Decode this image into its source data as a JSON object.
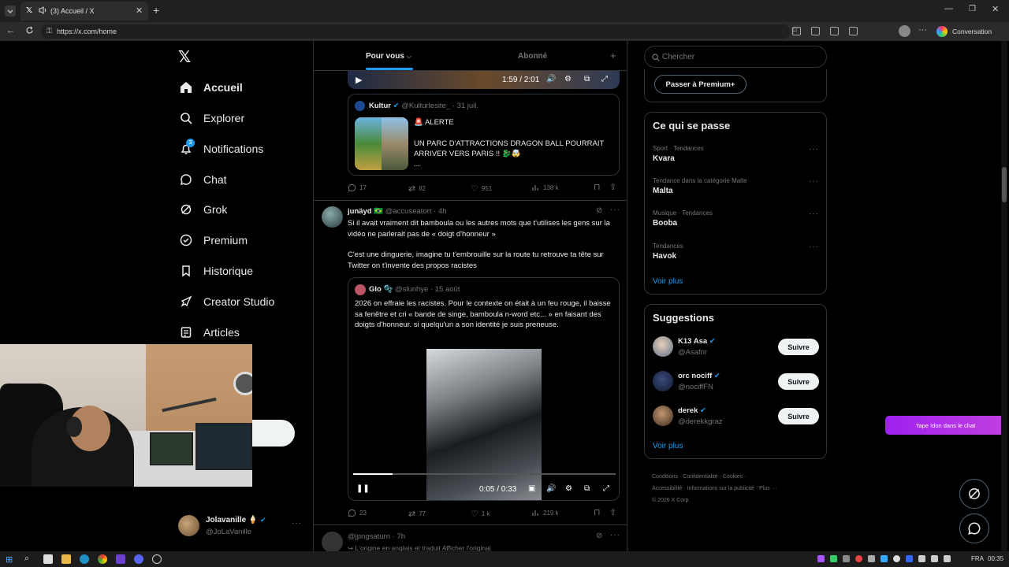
{
  "browser": {
    "tab_title": "(3) Accueil / X",
    "url": "https://x.com/home",
    "conversation_label": "Conversation"
  },
  "sidebar": {
    "items": [
      {
        "label": "Accueil",
        "icon": "home-icon"
      },
      {
        "label": "Explorer",
        "icon": "search-icon"
      },
      {
        "label": "Notifications",
        "icon": "bell-icon",
        "badge": "3"
      },
      {
        "label": "Chat",
        "icon": "chat-icon"
      },
      {
        "label": "Grok",
        "icon": "grok-icon"
      },
      {
        "label": "Premium",
        "icon": "verified-icon"
      },
      {
        "label": "Historique",
        "icon": "bookmark-icon"
      },
      {
        "label": "Creator Studio",
        "icon": "rocket-icon"
      },
      {
        "label": "Articles",
        "icon": "article-icon"
      }
    ],
    "account": {
      "name": "Jolavanille",
      "emoji": "🍦",
      "handle": "@JoLaVanille"
    }
  },
  "feed": {
    "tabs": [
      "Pour vous",
      "Abonné"
    ],
    "video1": {
      "time": "1:59 / 2:01"
    },
    "quote1": {
      "author": "Kultur",
      "handle": "@Kulturlesite_",
      "date": "· 31 juil.",
      "line1": "🚨 ALERTE",
      "line2": "UN PARC D'ATTRACTIONS DRAGON BALL POURRAIT ARRIVER VERS PARIS !! 🐉🤯",
      "line3": "..."
    },
    "stats1": {
      "replies": "17",
      "retweets": "82",
      "likes": "951",
      "views": "138 k"
    },
    "tweet2": {
      "author": "junäyd 🇧🇷",
      "handle": "@accuseatort",
      "time": "· 4h",
      "text1": "Si il avait vraiment dit bamboula ou les autres mots que t'utilises les gens sur la vidéo ne parlerait pas de « doigt d'honneur »",
      "text2": "C'est une dinguerie, imagine tu t'embrouille sur la route tu retrouve ta tête sur Twitter on t'invente des propos racistes",
      "quote": {
        "author": "Glo 🫧",
        "handle": "@slunhye",
        "date": "· 15 août",
        "text": "2026 on effraie les racistes. Pour le contexte on était à un feu rouge, il baisse sa fenêtre et cri «  bande de singe, bamboula n-word etc... » en faisant des doigts d'honneur. si quelqu'un a son identité je suis preneuse."
      },
      "video_time": "0:05 / 0:33",
      "video_progress": 0.15,
      "stats": {
        "replies": "23",
        "retweets": "77",
        "likes": "1 k",
        "views": "219 k"
      }
    },
    "tweet3": {
      "handle": "@jpngsaturn",
      "time": "· 7h",
      "line": "↪ L'origine en anglais et traduit  Afficher l'original"
    }
  },
  "right": {
    "search_placeholder": "Chercher",
    "premium_button": "Passer à Premium+",
    "trends_title": "Ce qui se passe",
    "trends": [
      {
        "cat": "Sport · Tendances",
        "name": "Kvara"
      },
      {
        "cat": "Tendance dans la catégorie Malte",
        "name": "Malta"
      },
      {
        "cat": "Musique · Tendances",
        "name": "Booba"
      },
      {
        "cat": "Tendances",
        "name": "Havok"
      }
    ],
    "see_more": "Voir plus",
    "suggestions_title": "Suggestions",
    "suggestions": [
      {
        "name": "K13 Asa",
        "handle": "@Asafnr",
        "button": "Suivre"
      },
      {
        "name": "orc nociff",
        "handle": "@nociffFN",
        "button": "Suivre"
      },
      {
        "name": "derek",
        "handle": "@derekkgraz",
        "button": "Suivre"
      }
    ],
    "see_more2": "Voir plus",
    "footer_line1": "Conditions  ·  Confidentialité  ·  Cookies  ·",
    "footer_line2": "Accessibilité  ·  Informations sur la publicité  ·  Plus ···",
    "footer_line3": "© 2026 X Corp."
  },
  "overlay": {
    "chat_banner": "Tape !don dans le chat"
  },
  "taskbar": {
    "lang": "FRA",
    "clock": "00:35"
  },
  "colors": {
    "accent": "#1d9bf0",
    "bg": "#000000",
    "border": "#2f3336",
    "banner": "#a020f0"
  }
}
